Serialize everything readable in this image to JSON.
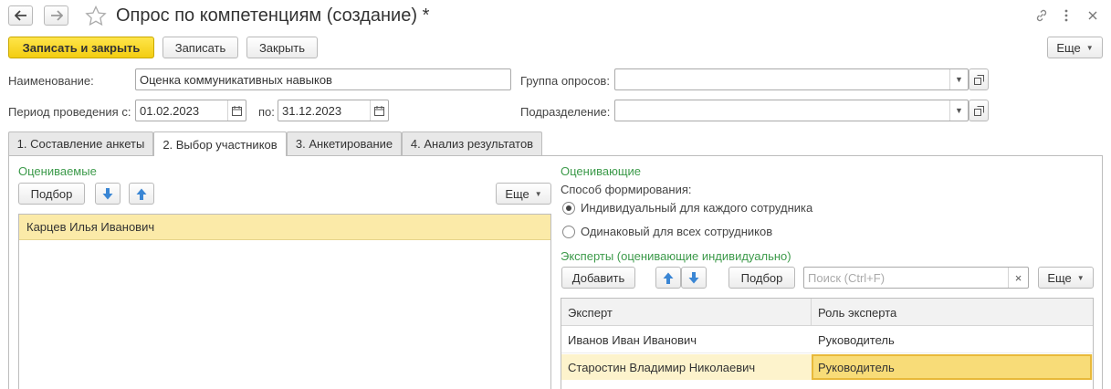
{
  "window": {
    "title": "Опрос по компетенциям (создание) *"
  },
  "toolbar": {
    "save_close_label": "Записать и закрыть",
    "save_label": "Записать",
    "close_label": "Закрыть",
    "more_label": "Еще"
  },
  "form": {
    "name_label": "Наименование:",
    "name_value": "Оценка коммуникативных навыков",
    "group_label": "Группа опросов:",
    "group_value": "",
    "period_label": "Период проведения с:",
    "period_from": "01.02.2023",
    "period_to_label": "по:",
    "period_to": "31.12.2023",
    "department_label": "Подразделение:",
    "department_value": ""
  },
  "tabs": [
    {
      "label": "1. Составление анкеты",
      "active": false
    },
    {
      "label": "2. Выбор участников",
      "active": true
    },
    {
      "label": "3. Анкетирование",
      "active": false
    },
    {
      "label": "4. Анализ результатов",
      "active": false
    }
  ],
  "evaluated": {
    "title": "Оцениваемые",
    "pick_label": "Подбор",
    "more_label": "Еще",
    "rows": [
      "Карцев Илья Иванович"
    ]
  },
  "evaluators": {
    "title": "Оценивающие",
    "method_label": "Способ формирования:",
    "options": [
      {
        "label": "Индивидуальный для каждого сотрудника",
        "selected": true
      },
      {
        "label": "Одинаковый для всех сотрудников",
        "selected": false
      }
    ],
    "experts_title": "Эксперты (оценивающие индивидуально)",
    "add_label": "Добавить",
    "pick_label": "Подбор",
    "search_placeholder": "Поиск (Ctrl+F)",
    "more_label": "Еще",
    "columns": [
      "Эксперт",
      "Роль эксперта"
    ],
    "rows": [
      {
        "expert": "Иванов Иван Иванович",
        "role": "Руководитель"
      },
      {
        "expert": "Старостин Владимир Николаевич",
        "role": "Руководитель"
      }
    ]
  },
  "colors": {
    "accent_yellow": "#f3cd11",
    "selection": "#fbeaa8",
    "group_title_green": "#3c9a4a",
    "arrow_blue": "#3a86d4"
  }
}
